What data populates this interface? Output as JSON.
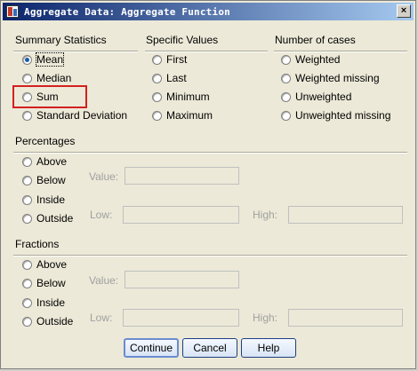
{
  "window": {
    "title": "Aggregate Data: Aggregate Function",
    "close_label": "×"
  },
  "summary_statistics": {
    "heading": "Summary Statistics",
    "options": [
      {
        "label": "Mean",
        "checked": true
      },
      {
        "label": "Median",
        "checked": false
      },
      {
        "label": "Sum",
        "checked": false
      },
      {
        "label": "Standard Deviation",
        "checked": false
      }
    ]
  },
  "specific_values": {
    "heading": "Specific Values",
    "options": [
      "First",
      "Last",
      "Minimum",
      "Maximum"
    ]
  },
  "number_of_cases": {
    "heading": "Number of cases",
    "options": [
      "Weighted",
      "Weighted missing",
      "Unweighted",
      "Unweighted missing"
    ]
  },
  "percentages": {
    "heading": "Percentages",
    "options": [
      "Above",
      "Below",
      "Inside",
      "Outside"
    ],
    "value_label": "Value:",
    "low_label": "Low:",
    "high_label": "High:",
    "value": "",
    "low": "",
    "high": ""
  },
  "fractions": {
    "heading": "Fractions",
    "options": [
      "Above",
      "Below",
      "Inside",
      "Outside"
    ],
    "value_label": "Value:",
    "low_label": "Low:",
    "high_label": "High:",
    "value": "",
    "low": "",
    "high": ""
  },
  "buttons": {
    "continue": "Continue",
    "cancel": "Cancel",
    "help": "Help"
  },
  "colors": {
    "titlebar_start": "#0a246a",
    "titlebar_end": "#a6caf0",
    "highlight": "#d42020",
    "radio_selected": "#1b5ea6"
  }
}
